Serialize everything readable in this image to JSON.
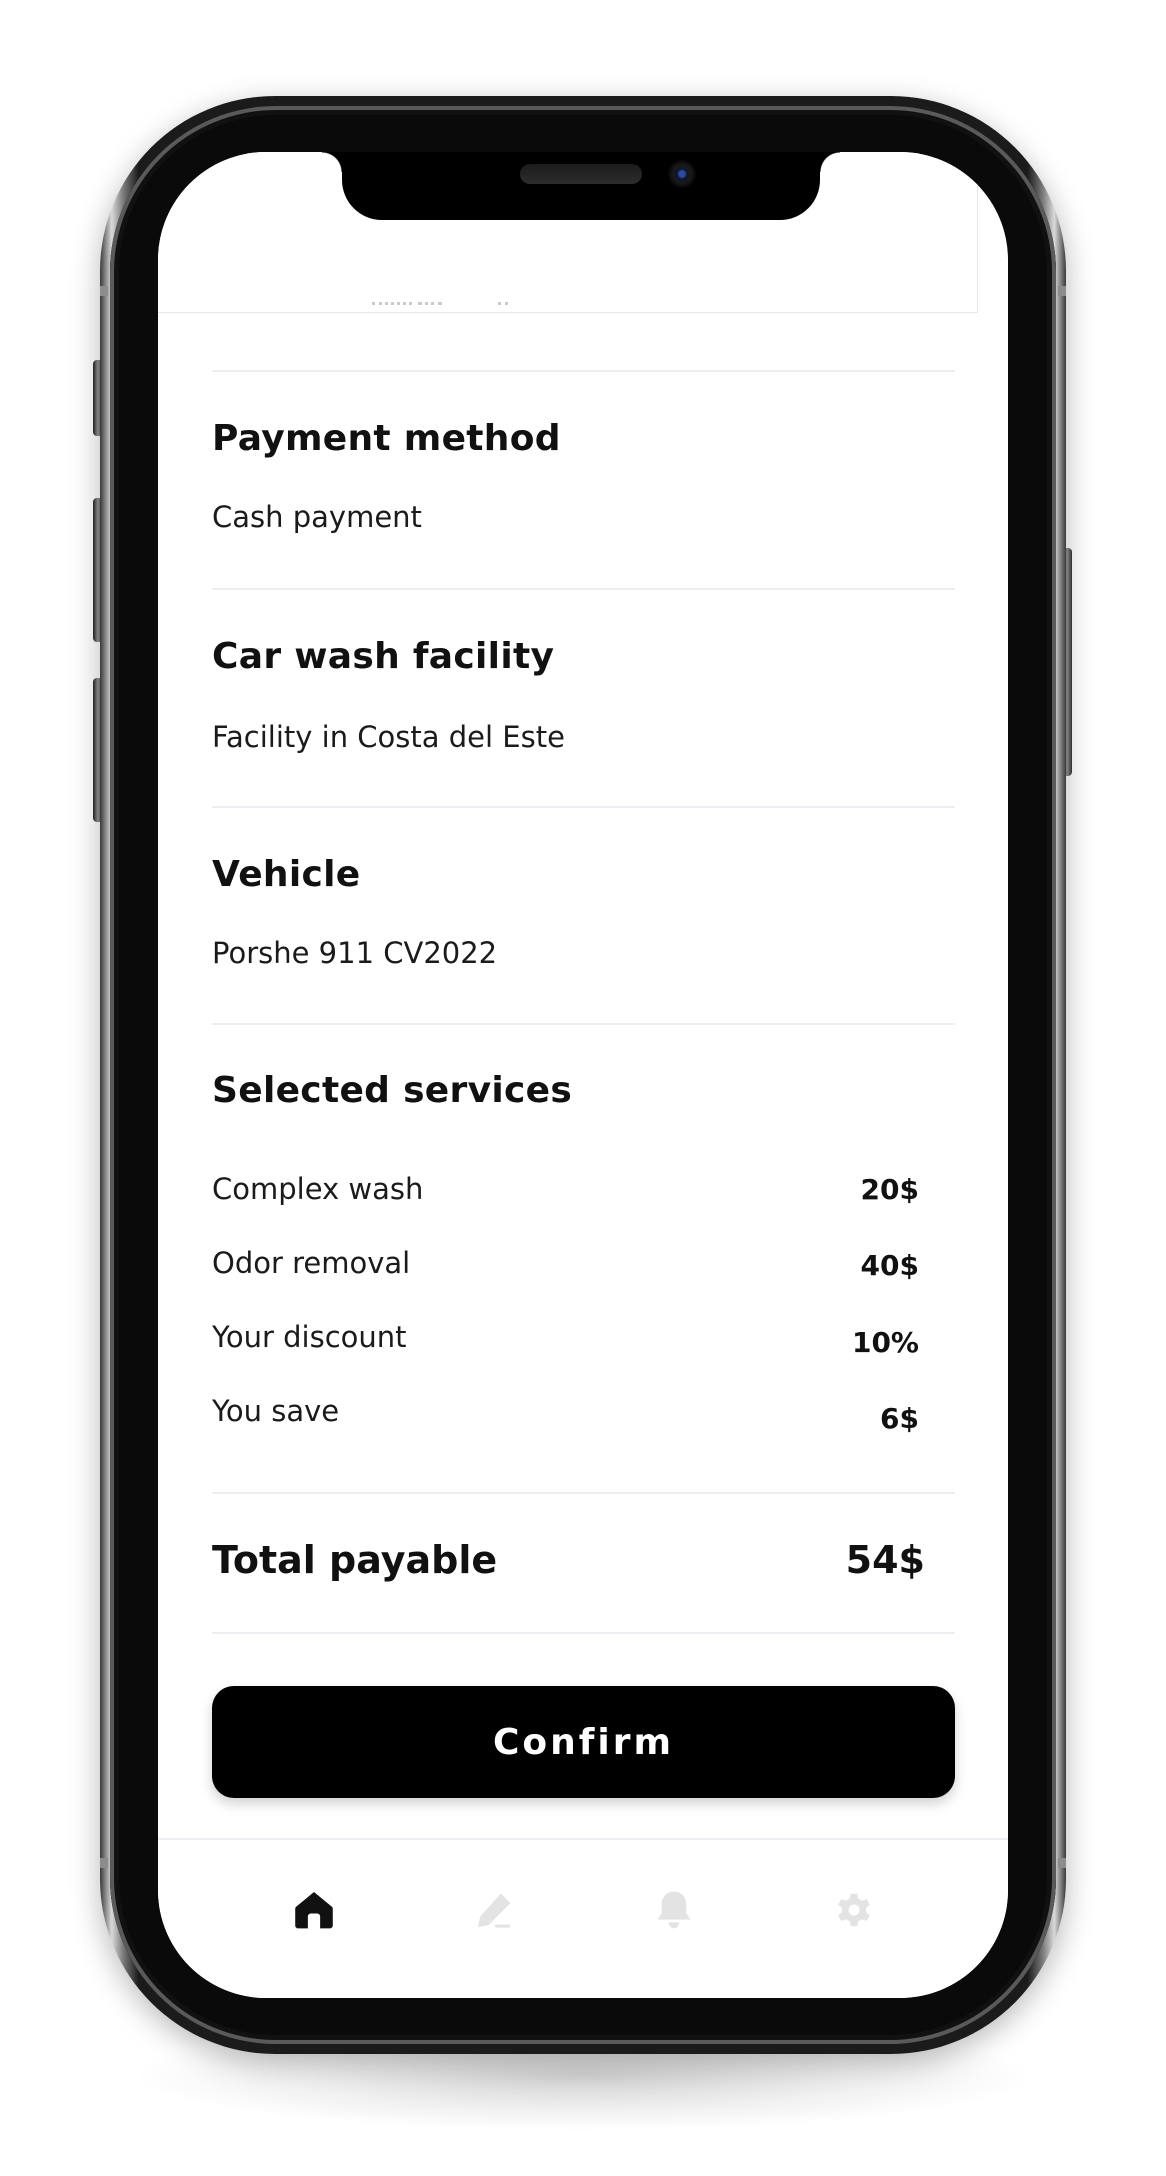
{
  "sections": {
    "payment": {
      "title": "Payment method",
      "value": "Cash payment"
    },
    "facility": {
      "title": "Car wash facility",
      "value": "Facility in Costa del Este"
    },
    "vehicle": {
      "title": "Vehicle",
      "value": "Porshe 911 CV2022"
    },
    "services": {
      "title": "Selected services",
      "items": [
        {
          "name": "Complex wash",
          "price": "20$"
        },
        {
          "name": "Odor removal",
          "price": "40$"
        },
        {
          "name": "Your discount",
          "price": "10%"
        },
        {
          "name": "You save",
          "price": "6$"
        }
      ]
    }
  },
  "total": {
    "label": "Total payable",
    "value": "54$"
  },
  "confirm_label": "Confirm",
  "tabbar": {
    "items": [
      {
        "icon": "home-icon",
        "active": true
      },
      {
        "icon": "edit-icon",
        "active": false
      },
      {
        "icon": "bell-icon",
        "active": false
      },
      {
        "icon": "gear-icon",
        "active": false
      }
    ],
    "active_color": "#111111",
    "inactive_color": "#e3e3e3"
  }
}
